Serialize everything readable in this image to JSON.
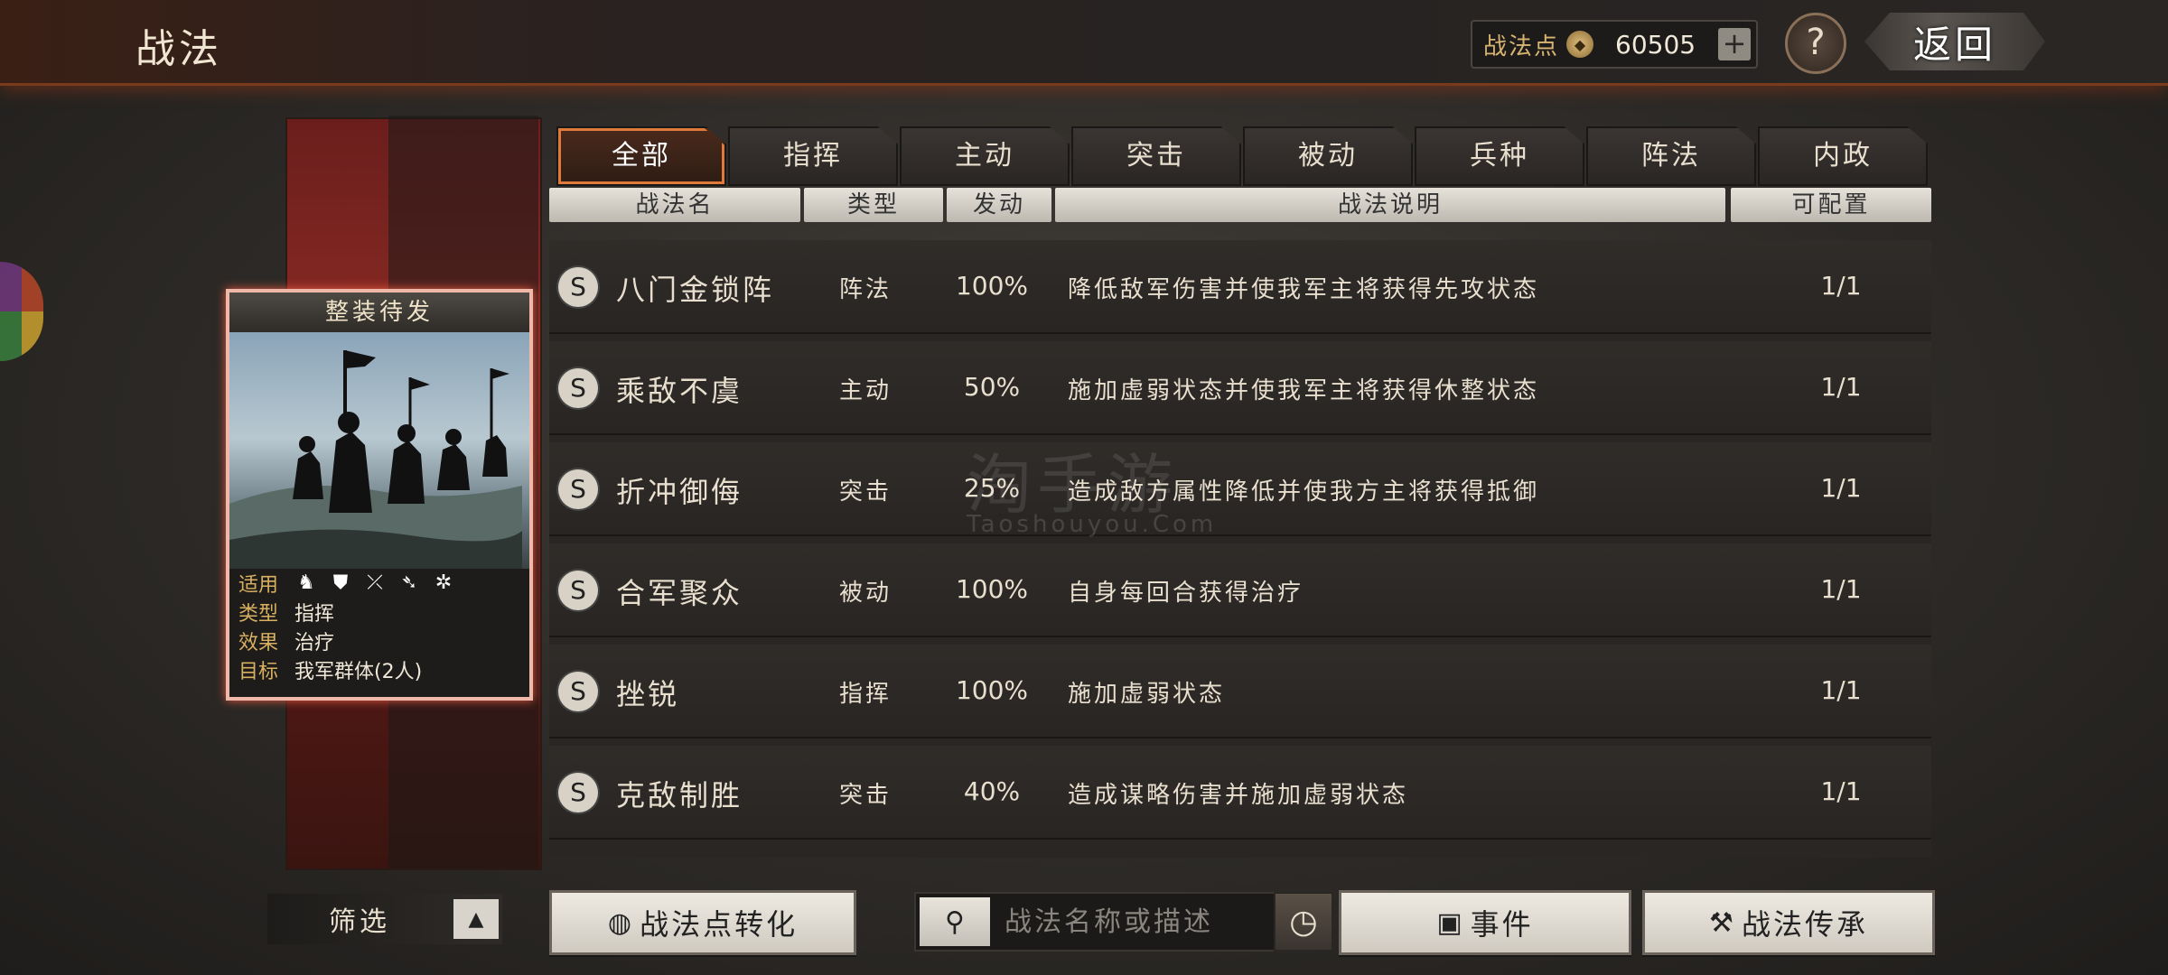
{
  "header": {
    "title": "战法",
    "points_label": "战法点",
    "points_value": "60505",
    "plus_icon": "+",
    "help_icon": "?",
    "back_label": "返回"
  },
  "card": {
    "name": "整装待发",
    "rows": [
      {
        "k": "适用",
        "v": ""
      },
      {
        "k": "类型",
        "v": "指挥"
      },
      {
        "k": "效果",
        "v": "治疗"
      },
      {
        "k": "目标",
        "v": "我军群体(2人)"
      }
    ],
    "unit_icons": [
      "cavalry-icon",
      "shield-icon",
      "bow-icon",
      "spear-icon",
      "wheel-icon"
    ]
  },
  "tabs": [
    {
      "label": "全部",
      "active": true
    },
    {
      "label": "指挥"
    },
    {
      "label": "主动"
    },
    {
      "label": "突击"
    },
    {
      "label": "被动"
    },
    {
      "label": "兵种"
    },
    {
      "label": "阵法"
    },
    {
      "label": "内政"
    }
  ],
  "columns": {
    "name": "战法名",
    "type": "类型",
    "trigger": "发动",
    "desc": "战法说明",
    "config": "可配置"
  },
  "tactics": [
    {
      "grade": "S",
      "name": "八门金锁阵",
      "type": "阵法",
      "rate": "100%",
      "desc": "降低敌军伤害并使我军主将获得先攻状态",
      "config": "1/1"
    },
    {
      "grade": "S",
      "name": "乘敌不虞",
      "type": "主动",
      "rate": "50%",
      "desc": "施加虚弱状态并使我军主将获得休整状态",
      "config": "1/1"
    },
    {
      "grade": "S",
      "name": "折冲御侮",
      "type": "突击",
      "rate": "25%",
      "desc": "造成敌方属性降低并使我方主将获得抵御",
      "config": "1/1"
    },
    {
      "grade": "S",
      "name": "合军聚众",
      "type": "被动",
      "rate": "100%",
      "desc": "自身每回合获得治疗",
      "config": "1/1"
    },
    {
      "grade": "S",
      "name": "挫锐",
      "type": "指挥",
      "rate": "100%",
      "desc": "施加虚弱状态",
      "config": "1/1"
    },
    {
      "grade": "S",
      "name": "克敌制胜",
      "type": "突击",
      "rate": "40%",
      "desc": "造成谋略伤害并施加虚弱状态",
      "config": "1/1"
    }
  ],
  "watermark": {
    "text": "淘手游",
    "sub": "Taoshouyou.Com"
  },
  "bottom": {
    "filter_label": "筛选",
    "convert_label": "战法点转化",
    "search_placeholder": "战法名称或描述",
    "event_label": "事件",
    "inherit_label": "战法传承"
  }
}
